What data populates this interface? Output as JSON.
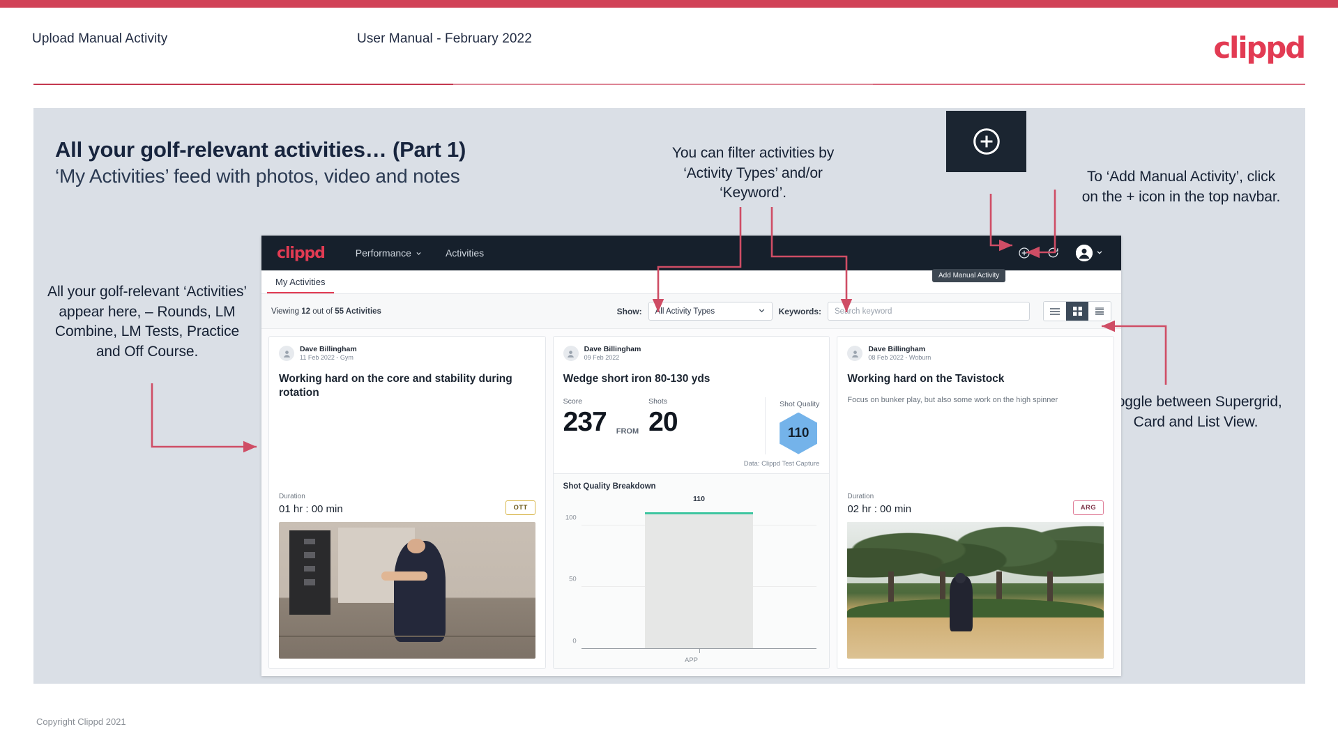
{
  "header": {
    "left_title": "Upload Manual Activity",
    "center_title": "User Manual - February 2022",
    "logo": "clippd"
  },
  "slide": {
    "heading": "All your golf-relevant activities… (Part 1)",
    "subheading": "‘My Activities’ feed with photos, video and notes",
    "plus_box_icon": "plus-circle-icon"
  },
  "callouts": {
    "filter": "You can filter activities by ‘Activity Types’ and/or ‘Keyword’.",
    "add_manual": "To ‘Add Manual Activity’, click on the + icon in the top navbar.",
    "activities_feed": "All your golf-relevant ‘Activities’ appear here, – Rounds, LM Combine, LM Tests, Practice and Off Course.",
    "toggle_view": "Toggle between Supergrid, Card and List View."
  },
  "app": {
    "navbar": {
      "logo": "clippd",
      "links": [
        {
          "label": "Performance",
          "has_caret": true
        },
        {
          "label": "Activities",
          "has_caret": false
        }
      ],
      "icons": [
        "plus-circle-icon",
        "refresh-icon",
        "account-avatar-icon",
        "chevron-down-icon"
      ],
      "tooltip": "Add Manual Activity"
    },
    "tabs": [
      {
        "label": "My Activities",
        "active": true
      }
    ],
    "filterbar": {
      "viewing_prefix": "Viewing ",
      "viewing_count": "12",
      "viewing_middle": " out of ",
      "viewing_total": "55 Activities",
      "show_label": "Show:",
      "activity_type_value": "All Activity Types",
      "keywords_label": "Keywords:",
      "keywords_placeholder": "Search keyword",
      "view_modes": [
        "list-view-icon",
        "supergrid-view-icon",
        "card-view-icon"
      ],
      "active_view_index": 1
    },
    "cards": [
      {
        "author": "Dave Billingham",
        "meta": "11 Feb 2022 - Gym",
        "title": "Working hard on the core and stability during rotation",
        "duration_label": "Duration",
        "duration_value": "01 hr : 00 min",
        "tag": "OTT",
        "tag_style": "ott",
        "photo": "gym-video-thumbnail"
      },
      {
        "author": "Dave Billingham",
        "meta": "09 Feb 2022",
        "title": "Wedge short iron 80-130 yds",
        "score_label": "Score",
        "score_value": "237",
        "from_label": "FROM",
        "shots_label": "Shots",
        "shots_value": "20",
        "shot_quality_label": "Shot Quality",
        "shot_quality_value": "110",
        "source": "Data: Clippd Test Capture"
      },
      {
        "author": "Dave Billingham",
        "meta": "08 Feb 2022 - Woburn",
        "title": "Working hard on the Tavistock",
        "note": "Focus on bunker play, but also some work on the high spinner",
        "duration_label": "Duration",
        "duration_value": "02 hr : 00 min",
        "tag": "ARG",
        "tag_style": "arg",
        "photo": "golf-course-bunker-photo"
      }
    ]
  },
  "chart_data": {
    "type": "bar",
    "title": "Shot Quality Breakdown",
    "categories": [
      "APP"
    ],
    "values": [
      110
    ],
    "data_labels": [
      "110"
    ],
    "yticks": [
      0,
      50,
      100
    ],
    "ytick_labels": [
      "0",
      "50",
      "100"
    ],
    "ylim": [
      0,
      125
    ],
    "xlabel": "APP",
    "ylabel": "",
    "grid": true,
    "legend": "none",
    "bar_fill_color": "#e6e7e6",
    "bar_cap_color": "#3ec6a0"
  },
  "colors": {
    "brand_red": "#e23b53",
    "top_bar": "#d14257",
    "panel_bg": "#dadfe6",
    "navbar_bg": "#16202c",
    "annotation_arrow": "#cf4d65",
    "hex_blue": "#74b3ea"
  },
  "footer": {
    "copyright": "Copyright Clippd 2021"
  }
}
